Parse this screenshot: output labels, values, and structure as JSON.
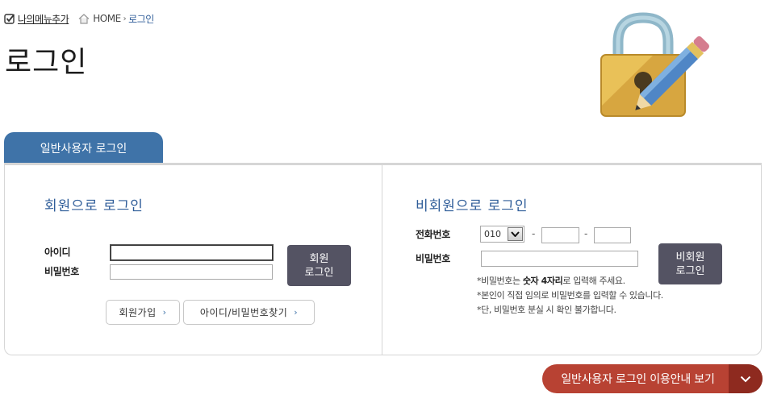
{
  "topbar": {
    "my_menu_label": "나의메뉴추가",
    "home_label": "HOME",
    "separator": "›",
    "current_label": "로그인"
  },
  "page": {
    "title": "로그인"
  },
  "tabs": {
    "active_label": "일반사용자 로그인"
  },
  "member": {
    "title": "회원으로 로그인",
    "id_label": "아이디",
    "pw_label": "비밀번호",
    "id_value": "",
    "pw_value": "",
    "login_label": "회원\n로그인",
    "join_label": "회원가입",
    "find_label": "아이디/비밀번호찾기",
    "arrow": "›"
  },
  "guest": {
    "title": "비회원으로 로그인",
    "phone_label": "전화번호",
    "pw_label": "비밀번호",
    "phone_prefix_selected": "010",
    "phone_mid_value": "",
    "phone_last_value": "",
    "pw_value": "",
    "dash": "-",
    "login_label": "비회원\n로그인",
    "notes": {
      "n1_pre": "비밀번호는 ",
      "n1_bold": "숫자 4자리",
      "n1_post": "로 입력해 주세요.",
      "n2": "본인이 직접 임의로 비밀번호를 입력할 수 있습니다.",
      "n3": "단, 비밀번호 분실 시 확인 불가합니다.",
      "bullet": "*"
    }
  },
  "guide": {
    "label": "일반사용자 로그인 이용안내 보기"
  },
  "colors": {
    "accent_blue": "#3f73a8",
    "title_blue": "#2f5d99",
    "dark_button": "#545363",
    "guide_red": "#b84233",
    "guide_red_dark": "#8e2a1f"
  }
}
